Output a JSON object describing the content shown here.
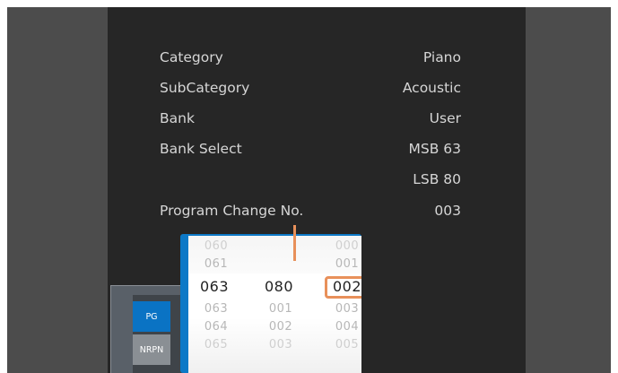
{
  "info": {
    "rows": [
      {
        "label": "Category",
        "value": "Piano"
      },
      {
        "label": "SubCategory",
        "value": "Acoustic"
      },
      {
        "label": "Bank",
        "value": "User"
      },
      {
        "label": "Bank Select",
        "value": "MSB 63"
      },
      {
        "label": "",
        "value": "LSB 80"
      },
      {
        "label": "Program Change No.",
        "value": "003"
      }
    ]
  },
  "side_window": {
    "tabs": [
      {
        "label": "PG",
        "active": true
      },
      {
        "label": "NRPN",
        "active": false
      }
    ]
  },
  "picker": {
    "columns": [
      {
        "items": [
          "060",
          "061",
          "063",
          "063",
          "064",
          "065"
        ],
        "selected_index": 2
      },
      {
        "items": [
          "080",
          "001",
          "002",
          "003"
        ],
        "selected_index": 0
      },
      {
        "items": [
          "000",
          "001",
          "002",
          "003",
          "004",
          "005"
        ],
        "selected_index": 2
      }
    ]
  },
  "colors": {
    "accent": "#0d79c7",
    "highlight": "#e8905a",
    "panel": "#262626",
    "background": "#4c4c4c"
  }
}
